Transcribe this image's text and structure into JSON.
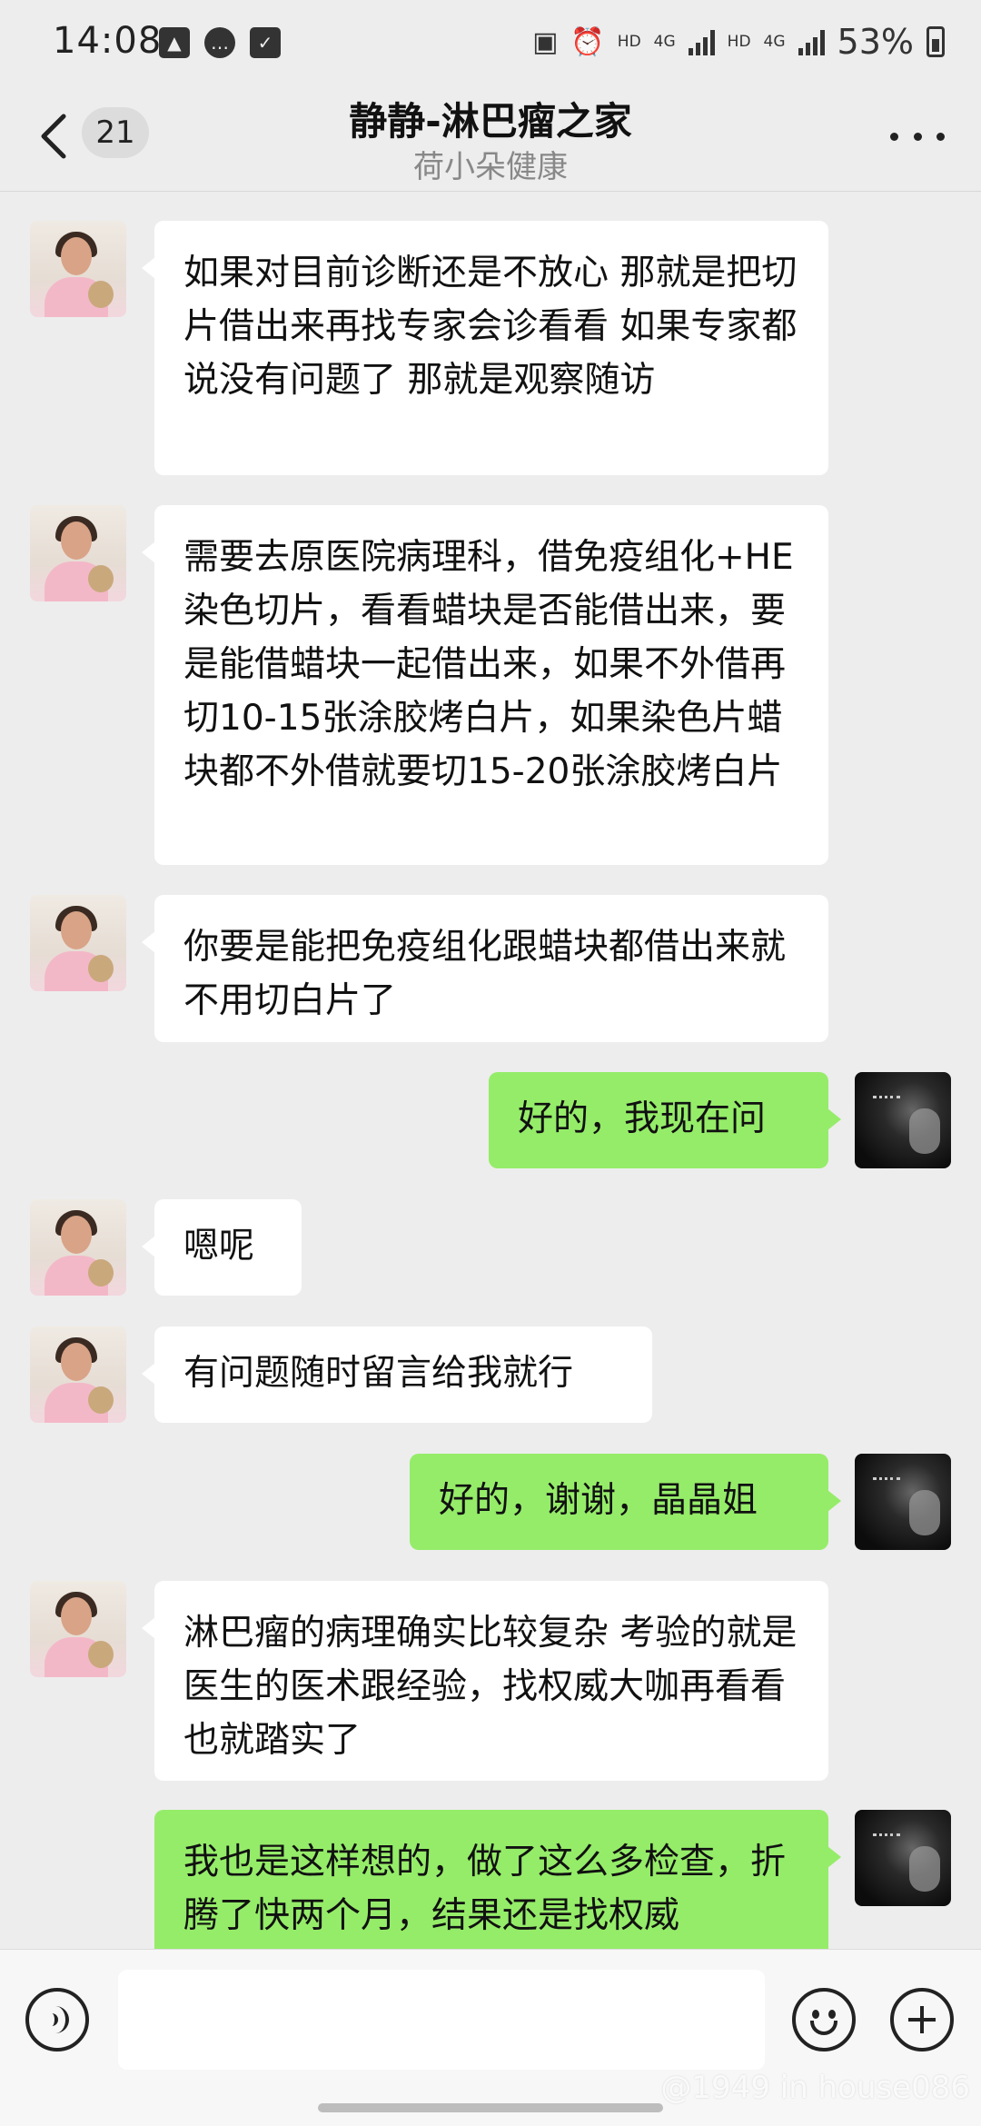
{
  "status_bar": {
    "time": "14:08",
    "network_label_1": "HD",
    "network_gen_1": "4G",
    "network_label_2": "HD",
    "network_gen_2": "4G",
    "battery_percent": "53%"
  },
  "header": {
    "unread_count": "21",
    "title": "静静-淋巴瘤之家",
    "subtitle": "荷小朵健康"
  },
  "messages": [
    {
      "sender": "other",
      "text": "如果对目前诊断还是不放心 那就是把切片借出来再找专家会诊看看 如果专家都说没有问题了 那就是观察随访"
    },
    {
      "sender": "other",
      "text": "需要去原医院病理科，借免疫组化+HE染色切片，看看蜡块是否能借出来，要是能借蜡块一起借出来，如果不外借再切10-15张涂胶烤白片，如果染色片蜡块都不外借就要切15-20张涂胶烤白片"
    },
    {
      "sender": "other",
      "text": "你要是能把免疫组化跟蜡块都借出来就不用切白片了"
    },
    {
      "sender": "self",
      "text": "好的，我现在问"
    },
    {
      "sender": "other",
      "text": "嗯呢"
    },
    {
      "sender": "other",
      "text": "有问题随时留言给我就行"
    },
    {
      "sender": "self",
      "text": "好的，谢谢，晶晶姐"
    },
    {
      "sender": "other",
      "text": "淋巴瘤的病理确实比较复杂 考验的就是医生的医术跟经验，找权威大咖再看看也就踏实了"
    },
    {
      "sender": "self",
      "text": "我也是这样想的，做了这么多检查，折腾了快两个月，结果还是找权威"
    }
  ],
  "input": {
    "value": "",
    "placeholder": ""
  },
  "watermark": "@1949 in house086",
  "colors": {
    "background": "#ededed",
    "self_bubble": "#95ec69",
    "other_bubble": "#ffffff"
  }
}
